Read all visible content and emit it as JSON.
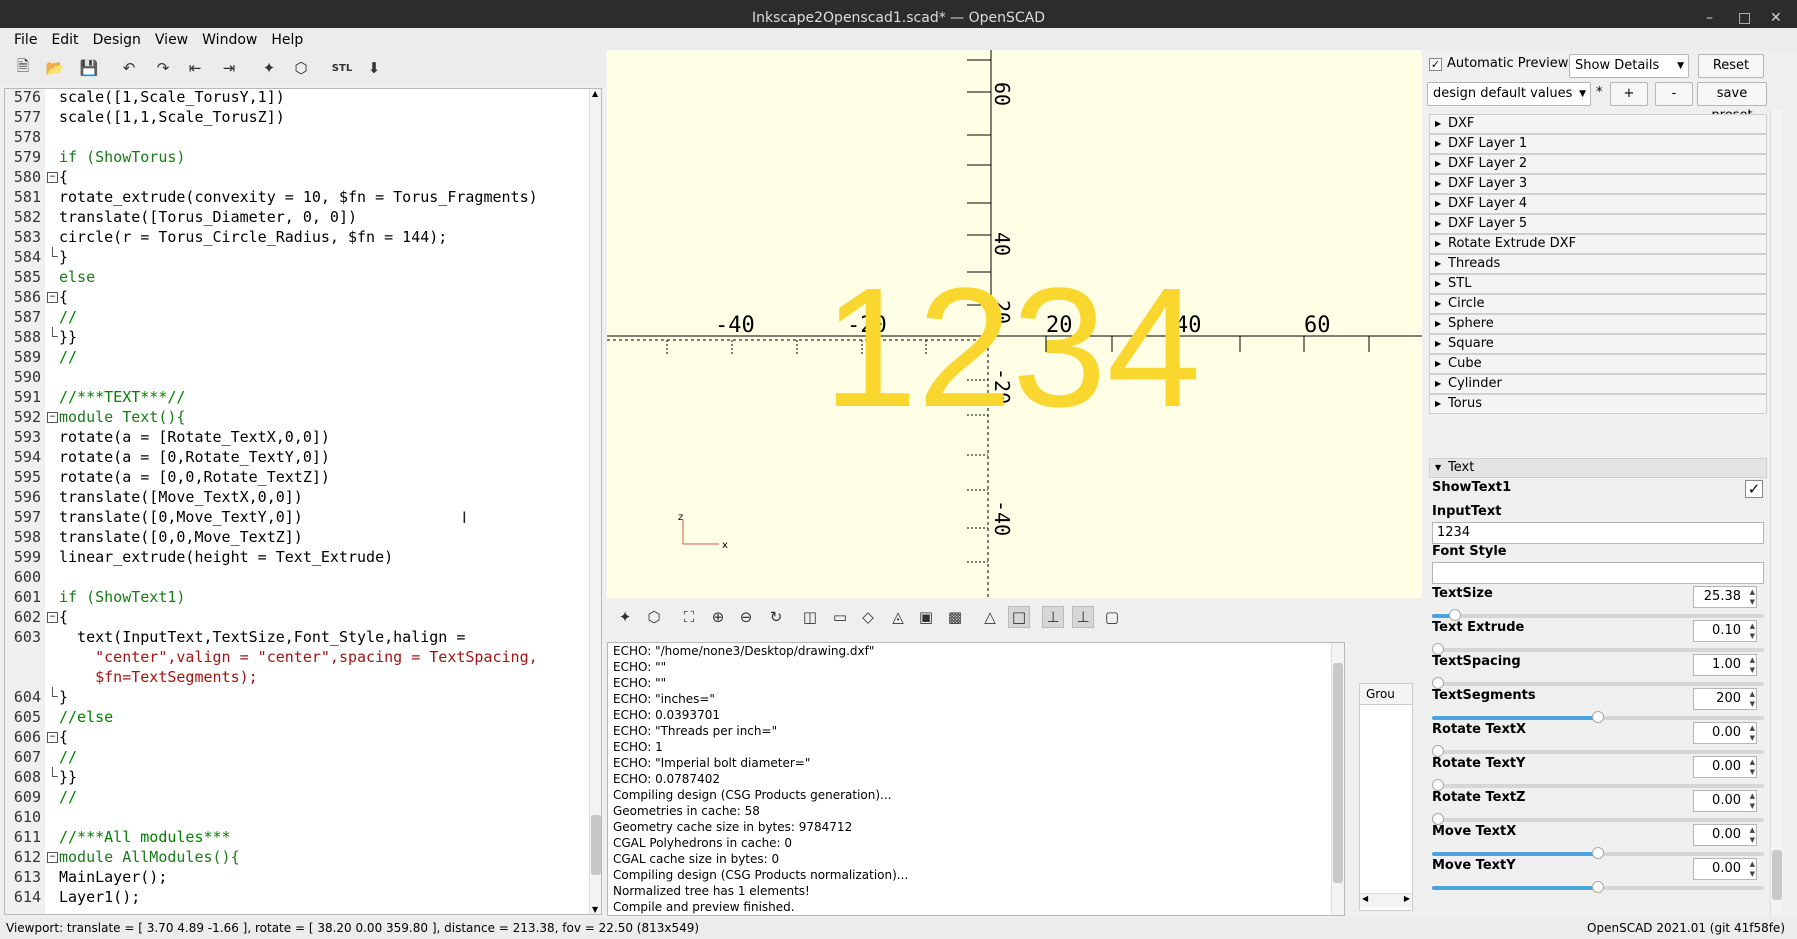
{
  "window": {
    "title": "Inkscape2Openscad1.scad* — OpenSCAD"
  },
  "menu": [
    "File",
    "Edit",
    "Design",
    "View",
    "Window",
    "Help"
  ],
  "editor": {
    "lines": [
      {
        "n": "576",
        "t": "scale([1,Scale_TorusY,1])"
      },
      {
        "n": "577",
        "t": "scale([1,1,Scale_TorusZ])"
      },
      {
        "n": "578",
        "t": ""
      },
      {
        "n": "579",
        "t": "if (ShowTorus)"
      },
      {
        "n": "580",
        "t": "{"
      },
      {
        "n": "581",
        "t": "rotate_extrude(convexity = 10, $fn = Torus_Fragments)"
      },
      {
        "n": "582",
        "t": "translate([Torus_Diameter, 0, 0])"
      },
      {
        "n": "583",
        "t": "circle(r = Torus_Circle_Radius, $fn = 144);"
      },
      {
        "n": "584",
        "t": "}"
      },
      {
        "n": "585",
        "t": "else"
      },
      {
        "n": "586",
        "t": "{"
      },
      {
        "n": "587",
        "t": "//"
      },
      {
        "n": "588",
        "t": "}}"
      },
      {
        "n": "589",
        "t": "//"
      },
      {
        "n": "590",
        "t": ""
      },
      {
        "n": "591",
        "t": "//***TEXT***//"
      },
      {
        "n": "592",
        "t": "module Text(){"
      },
      {
        "n": "593",
        "t": "rotate(a = [Rotate_TextX,0,0])"
      },
      {
        "n": "594",
        "t": "rotate(a = [0,Rotate_TextY,0])"
      },
      {
        "n": "595",
        "t": "rotate(a = [0,0,Rotate_TextZ])"
      },
      {
        "n": "596",
        "t": "translate([Move_TextX,0,0])"
      },
      {
        "n": "597",
        "t": "translate([0,Move_TextY,0])"
      },
      {
        "n": "598",
        "t": "translate([0,0,Move_TextZ])"
      },
      {
        "n": "599",
        "t": "linear_extrude(height = Text_Extrude)"
      },
      {
        "n": "600",
        "t": ""
      },
      {
        "n": "601",
        "t": "if (ShowText1)"
      },
      {
        "n": "602",
        "t": "{"
      },
      {
        "n": "603",
        "t": "  text(InputText,TextSize,Font_Style,halign ="
      },
      {
        "n": "",
        "t": "    \"center\",valign = \"center\",spacing = TextSpacing,"
      },
      {
        "n": "",
        "t": "    $fn=TextSegments);"
      },
      {
        "n": "604",
        "t": "}"
      },
      {
        "n": "605",
        "t": "//else"
      },
      {
        "n": "606",
        "t": "{"
      },
      {
        "n": "607",
        "t": "//"
      },
      {
        "n": "608",
        "t": "}}"
      },
      {
        "n": "609",
        "t": "//"
      },
      {
        "n": "610",
        "t": ""
      },
      {
        "n": "611",
        "t": "//***All modules***"
      },
      {
        "n": "612",
        "t": "module AllModules(){"
      },
      {
        "n": "613",
        "t": "MainLayer();"
      },
      {
        "n": "614",
        "t": "Layer1();"
      }
    ]
  },
  "viewport": {
    "text3d": "1234",
    "x_ticks": [
      "-40",
      "-20",
      "20",
      "40",
      "60"
    ],
    "y_ticks_pos": [
      "60",
      "40",
      "20"
    ],
    "y_ticks_neg": [
      "-20",
      "-40"
    ],
    "axis_x": "x",
    "axis_z": "z"
  },
  "console": {
    "lines": [
      "ECHO: \"/home/none3/Desktop/drawing.dxf\"",
      "ECHO: \"\"",
      "ECHO: \"\"",
      "ECHO: \"inches=\"",
      "ECHO: 0.0393701",
      "ECHO: \"Threads per inch=\"",
      "ECHO: 1",
      "ECHO: \"Imperial bolt diameter=\"",
      "ECHO: 0.0787402",
      "Compiling design (CSG Products generation)...",
      "Geometries in cache: 58",
      "Geometry cache size in bytes: 9784712",
      "CGAL Polyhedrons in cache: 0",
      "CGAL cache size in bytes: 0",
      "Compiling design (CSG Products normalization)...",
      "Normalized tree has 1 elements!",
      "Compile and preview finished."
    ]
  },
  "group_panel": {
    "header": "Grou"
  },
  "customizer": {
    "auto_preview": "Automatic Preview",
    "show_details": "Show Details",
    "reset": "Reset",
    "preset": "design default values",
    "star": "*",
    "plus": "+",
    "minus": "-",
    "save_preset": "save preset",
    "groups": [
      "DXF",
      "DXF Layer 1",
      "DXF Layer 2",
      "DXF Layer 3",
      "DXF Layer 4",
      "DXF Layer 5",
      "Rotate Extrude DXF",
      "Threads",
      "STL",
      "Circle",
      "Sphere",
      "Square",
      "Cube",
      "Cylinder",
      "Torus"
    ],
    "open_group": "Text",
    "showtext_label": "ShowText1",
    "showtext_checked": true,
    "inputtext_label": "InputText",
    "inputtext_value": "1234",
    "fontstyle_label": "Font Style",
    "fontstyle_value": "",
    "params": [
      {
        "label": "TextSize",
        "value": "25.38",
        "fraction": 0.07
      },
      {
        "label": "Text Extrude",
        "value": "0.10",
        "fraction": 0.0
      },
      {
        "label": "TextSpacing",
        "value": "1.00",
        "fraction": 0.0
      },
      {
        "label": "TextSegments",
        "value": "200",
        "fraction": 0.5
      },
      {
        "label": "Rotate TextX",
        "value": "0.00",
        "fraction": 0.0
      },
      {
        "label": "Rotate TextY",
        "value": "0.00",
        "fraction": 0.0
      },
      {
        "label": "Rotate TextZ",
        "value": "0.00",
        "fraction": 0.0
      },
      {
        "label": "Move TextX",
        "value": "0.00",
        "fraction": 0.5
      },
      {
        "label": "Move TextY",
        "value": "0.00",
        "fraction": 0.5
      }
    ]
  },
  "status": {
    "left": "Viewport: translate = [ 3.70 4.89 -1.66 ], rotate = [ 38.20 0.00 359.80 ], distance = 213.38, fov = 22.50 (813x549)",
    "right": "OpenSCAD 2021.01 (git 41f58fe)"
  },
  "colors": {
    "viewport_bg": "#ffffe5",
    "text3d": "#f9d72f",
    "accent": "#4aa3df"
  }
}
